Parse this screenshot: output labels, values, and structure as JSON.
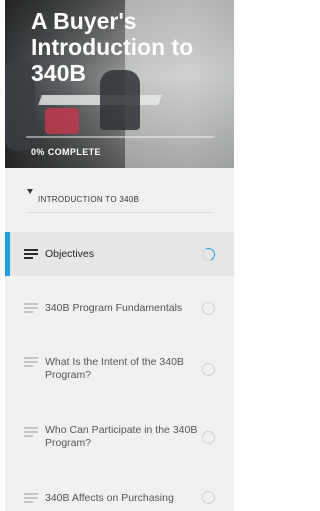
{
  "course": {
    "title": "A Buyer's Introduction to 340B",
    "progress_label": "0% COMPLETE",
    "progress_percent": 0
  },
  "sidebar": {
    "section_title": "INTRODUCTION TO 340B",
    "lessons": [
      {
        "label": "Objectives",
        "state": "in-progress"
      },
      {
        "label": "340B Program Fundamentals",
        "state": "not-started"
      },
      {
        "label": "What Is the Intent of the 340B Program?",
        "state": "not-started"
      },
      {
        "label": "Who Can Participate in the 340B Program?",
        "state": "not-started"
      },
      {
        "label": "340B Affects on Purchasing",
        "state": "not-started"
      }
    ]
  },
  "colors": {
    "accent": "#1e9fe0",
    "sidebar_bg": "#f1f1f1",
    "active_bg": "#e6e6e6"
  }
}
